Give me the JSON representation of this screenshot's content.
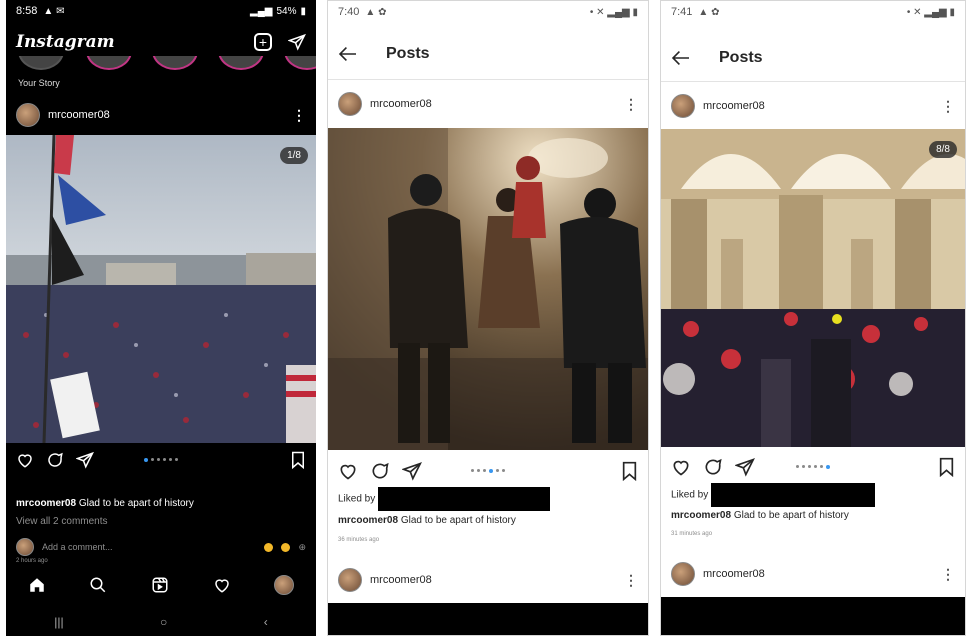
{
  "screens": [
    {
      "status": {
        "time": "8:58",
        "battery": "54%"
      },
      "app_logo": "Instagram",
      "your_story": "Your Story",
      "post": {
        "username": "mrcoomer08",
        "photo_counter": "1/8",
        "caption_user": "mrcoomer08",
        "caption_text": "Glad to be apart of history",
        "view_comments": "View all 2 comments",
        "add_comment_placeholder": "Add a comment...",
        "time_ago": "2 hours ago",
        "carousel_index": 1,
        "carousel_total": 8
      }
    },
    {
      "status": {
        "time": "7:40"
      },
      "page_title": "Posts",
      "post": {
        "username": "mrcoomer08",
        "liked_by": "Liked by",
        "caption_user": "mrcoomer08",
        "caption_text": "Glad to be apart of history",
        "time_ago": "36 minutes ago",
        "carousel_index": 4,
        "carousel_total": 8
      },
      "next_post_username": "mrcoomer08"
    },
    {
      "status": {
        "time": "7:41"
      },
      "page_title": "Posts",
      "post": {
        "username": "mrcoomer08",
        "photo_counter": "8/8",
        "liked_by": "Liked by",
        "caption_user": "mrcoomer08",
        "caption_text": "Glad to be apart of history",
        "time_ago": "31 minutes ago",
        "carousel_index": 8,
        "carousel_total": 8
      },
      "next_post_username": "mrcoomer08"
    }
  ],
  "icons": [
    "heart-icon",
    "comment-icon",
    "share-icon",
    "bookmark-icon",
    "back-arrow-icon",
    "more-icon",
    "home-icon",
    "search-icon",
    "reels-icon",
    "new-post-icon",
    "direct-message-icon"
  ],
  "colors": {
    "accent": "#3897f0",
    "dark_bg": "#000000",
    "light_bg": "#ffffff"
  }
}
